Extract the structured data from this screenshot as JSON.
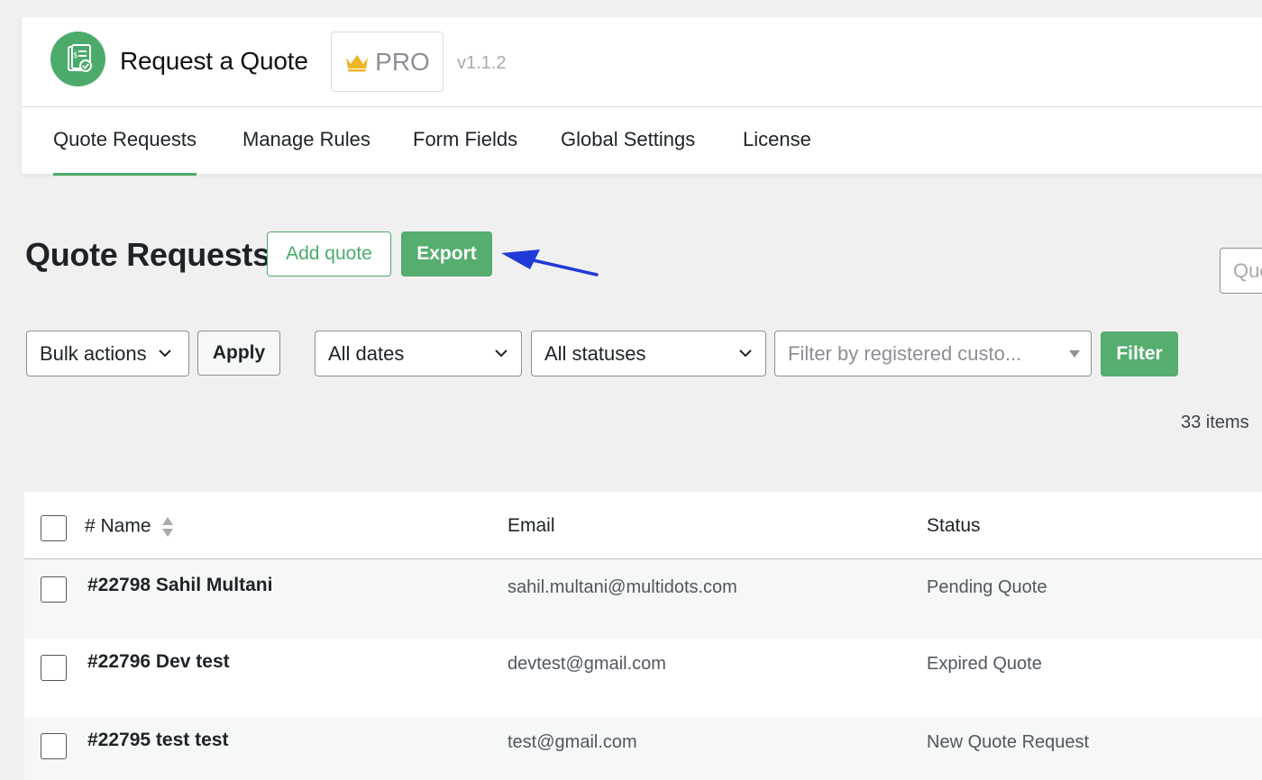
{
  "app": {
    "title": "Request a Quote",
    "pro_label": "PRO",
    "version": "v1.1.2",
    "logo_icon": "quote-document-icon",
    "crown_icon": "crown-icon"
  },
  "nav": {
    "tabs": [
      {
        "label": "Quote Requests",
        "active": true
      },
      {
        "label": "Manage Rules",
        "active": false
      },
      {
        "label": "Form Fields",
        "active": false
      },
      {
        "label": "Global Settings",
        "active": false
      },
      {
        "label": "License",
        "active": false
      }
    ]
  },
  "page": {
    "title": "Quote Requests",
    "add_quote_label": "Add quote",
    "export_label": "Export",
    "search_placeholder": "Quote"
  },
  "filters": {
    "bulk_actions": "Bulk actions",
    "apply_label": "Apply",
    "dates": "All dates",
    "statuses": "All statuses",
    "customer_placeholder": "Filter by registered custo...",
    "filter_label": "Filter"
  },
  "items_count": "33 items",
  "table": {
    "columns": [
      "# Name",
      "Email",
      "Status"
    ],
    "rows": [
      {
        "name": "#22798 Sahil Multani",
        "email": "sahil.multani@multidots.com",
        "status": "Pending Quote"
      },
      {
        "name": "#22796 Dev test",
        "email": "devtest@gmail.com",
        "status": "Expired Quote"
      },
      {
        "name": "#22795 test test",
        "email": "test@gmail.com",
        "status": "New Quote Request"
      }
    ]
  },
  "colors": {
    "brand_green": "#4cab6b",
    "annotation_arrow": "#1f3ad6"
  }
}
